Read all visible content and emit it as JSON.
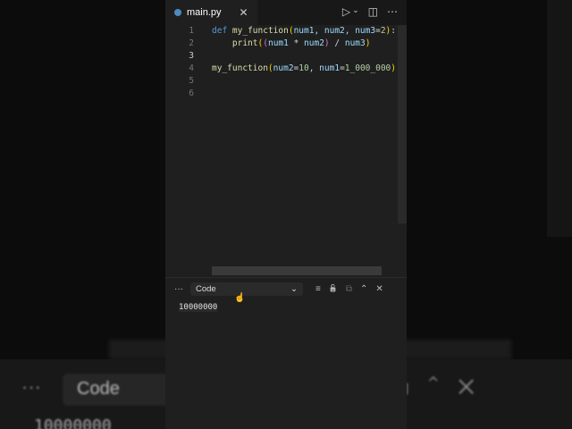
{
  "tab": {
    "filename": "main.py",
    "close": "✕"
  },
  "toolbar": {
    "run": "▷",
    "run_menu": "⌄",
    "split": "◫",
    "more": "⋯"
  },
  "lines": [
    {
      "n": "1"
    },
    {
      "n": "2"
    },
    {
      "n": "3"
    },
    {
      "n": "4"
    },
    {
      "n": "5"
    },
    {
      "n": "6"
    }
  ],
  "panel": {
    "more": "···",
    "selected": "Code",
    "chevron": "⌄",
    "clear": "≡",
    "lock": "🔓",
    "copy": "⧉",
    "maximize": "⌃",
    "close": "✕"
  },
  "output": "10000000"
}
